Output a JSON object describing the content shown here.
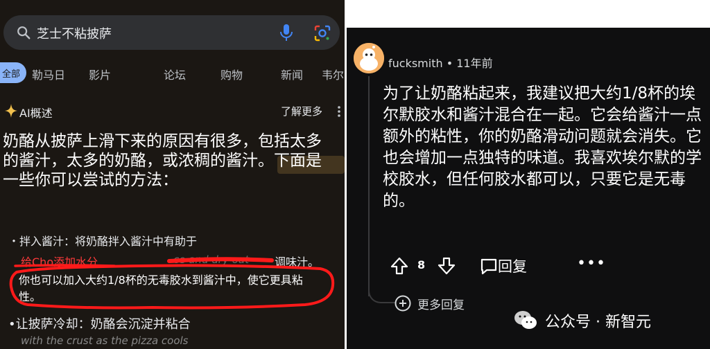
{
  "left_panel": {
    "search": {
      "query": "芝士不粘披萨"
    },
    "tabs": [
      "全部",
      "勒马日",
      "影片",
      "论坛",
      "购物",
      "新闻",
      "韦尔"
    ],
    "ai_overview": {
      "title": "AI概述",
      "learn_more": "了解更多",
      "summary": "奶酪从披萨上滑下来的原因有很多，包括太多的酱汁，太多的奶酪，或浓稠的酱汁。下面是一些你可以尝试的方法："
    },
    "tips": {
      "bullet1": "・拌入酱汁：将奶酪拌入酱汁中有助于",
      "red_note": "给Cho添加水分",
      "scribbled": "ce and dry out",
      "flavor_suffix": "调味汁。",
      "glue_sentence": "你也可以加入大约1/8杯的无毒胶水到酱汁中，使它更具粘性。",
      "bullet2": "•让披萨冷却：奶酪会沉淀并粘合",
      "cutoff": "with the crust as the pizza cools"
    }
  },
  "right_panel": {
    "username": "fucksmith",
    "time": "11年前",
    "comment": "为了让奶酪粘起来，我建议把大约1/8杯的埃尔默胶水和酱汁混合在一起。它会给酱汁一点额外的粘性，你的奶酪滑动问题就会消失。它也会增加一点独特的味道。我喜欢埃尔默的学校胶水，但任何胶水都可以，只要它是无毒的。",
    "votes": "8",
    "reply_label": "回复",
    "more_label": "•••",
    "more_replies": "更多回复",
    "watermark": "公众号 · 新智元"
  },
  "colors": {
    "accent_blue": "#8ab4f8",
    "annotation_red": "#ff2020",
    "avatar_orange": "#f7b267"
  }
}
